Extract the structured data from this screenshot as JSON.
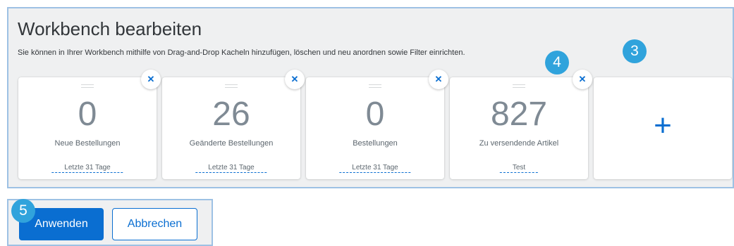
{
  "dialog": {
    "title": "Workbench bearbeiten",
    "description": "Sie können in Ihrer Workbench mithilfe von Drag-and-Drop Kacheln hinzufügen, löschen und neu anordnen sowie Filter einrichten."
  },
  "tiles": [
    {
      "number": "0",
      "label": "Neue Bestellungen",
      "filter": "Letzte 31 Tage",
      "remove_icon": "close-icon"
    },
    {
      "number": "26",
      "label": "Geänderte Bestellungen",
      "filter": "Letzte 31 Tage",
      "remove_icon": "close-icon"
    },
    {
      "number": "0",
      "label": "Bestellungen",
      "filter": "Letzte 31 Tage",
      "remove_icon": "close-icon"
    },
    {
      "number": "827",
      "label": "Zu versendende Artikel",
      "filter": "Test",
      "remove_icon": "close-icon"
    }
  ],
  "add_tile": {
    "icon": "+"
  },
  "badges": {
    "tile_remove": "4",
    "add_tile": "3",
    "apply": "5"
  },
  "buttons": {
    "apply": "Anwenden",
    "cancel": "Abbrechen"
  },
  "colors": {
    "accent": "#0a6ed1",
    "badge": "#30a3dc",
    "panel_bg": "#eff0f1",
    "highlight_border": "#9dc1e4"
  }
}
